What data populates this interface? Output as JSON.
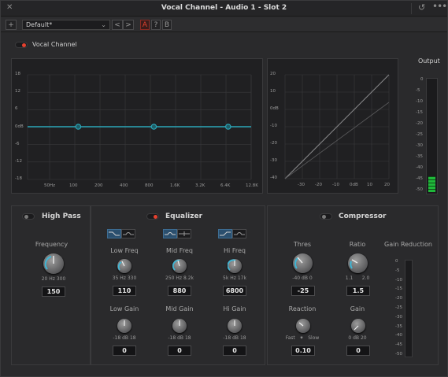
{
  "window": {
    "title": "Vocal Channel - Audio 1 -  Slot 2"
  },
  "toolbar": {
    "preset": "Default*",
    "btn_a": "A",
    "btn_b": "B",
    "btn_question": "?",
    "btn_prev": "<",
    "btn_next": ">",
    "btn_add": "+"
  },
  "plugin": {
    "name": "Vocal Channel",
    "enabled": true
  },
  "eq_graph": {
    "y_ticks": [
      "18",
      "12",
      "6",
      "0dB",
      "-6",
      "-12",
      "-18"
    ],
    "x_ticks": [
      "50Hz",
      "100",
      "200",
      "400",
      "800",
      "1.6K",
      "3.2K",
      "6.4K",
      "12.8K"
    ],
    "nodes_hz": [
      110,
      880,
      6800
    ]
  },
  "comp_graph": {
    "y_ticks": [
      "20",
      "10",
      "0dB",
      "-10",
      "-20",
      "-30",
      "-40"
    ],
    "x_ticks": [
      "-30",
      "-20",
      "-10",
      "0dB",
      "10",
      "20"
    ]
  },
  "output": {
    "label": "Output",
    "ticks": [
      "0",
      "-5",
      "-10",
      "-15",
      "-20",
      "-25",
      "-30",
      "-35",
      "-40",
      "-45",
      "-50"
    ],
    "level_fraction": 0.08
  },
  "highpass": {
    "title": "High Pass",
    "enabled": false,
    "freq": {
      "label": "Frequency",
      "min": "20",
      "unit": "Hz",
      "max": "300",
      "value": "150"
    }
  },
  "equalizer": {
    "title": "Equalizer",
    "enabled": true,
    "bands": [
      {
        "freq_label": "Low Freq",
        "min": "35",
        "unit": "Hz",
        "max": "330",
        "value": "110",
        "gain_label": "Low Gain",
        "gmin": "-18",
        "gunit": "dB",
        "gmax": "18",
        "gain": "0"
      },
      {
        "freq_label": "Mid Freq",
        "min": "250",
        "unit": "Hz",
        "max": "8.2k",
        "value": "880",
        "gain_label": "Mid Gain",
        "gmin": "-18",
        "gunit": "dB",
        "gmax": "18",
        "gain": "0"
      },
      {
        "freq_label": "Hi Freq",
        "min": "5k",
        "unit": "Hz",
        "max": "17k",
        "value": "6800",
        "gain_label": "Hi Gain",
        "gmin": "-18",
        "gunit": "dB",
        "gmax": "18",
        "gain": "0"
      }
    ]
  },
  "compressor": {
    "title": "Compressor",
    "enabled": false,
    "thres": {
      "label": "Thres",
      "min": "-40",
      "unit": "dB",
      "max": "0",
      "value": "-25"
    },
    "ratio": {
      "label": "Ratio",
      "min": "1.1",
      "max": "2.0",
      "value": "1.5"
    },
    "reaction": {
      "label": "Reaction",
      "min": "Fast",
      "max": "Slow",
      "value": "0.10"
    },
    "gain": {
      "label": "Gain",
      "min": "0",
      "unit": "dB",
      "max": "20",
      "value": "0"
    },
    "gain_reduction": {
      "label": "Gain Reduction",
      "ticks": [
        "0",
        "-5",
        "-10",
        "-15",
        "-20",
        "-25",
        "-30",
        "-35",
        "-40",
        "-45",
        "-50"
      ]
    }
  },
  "colors": {
    "accent": "#2aa6b8",
    "record_red": "#e5412f",
    "meter_green": "#1fb83a",
    "knob_arc": "#3fb7d6"
  }
}
